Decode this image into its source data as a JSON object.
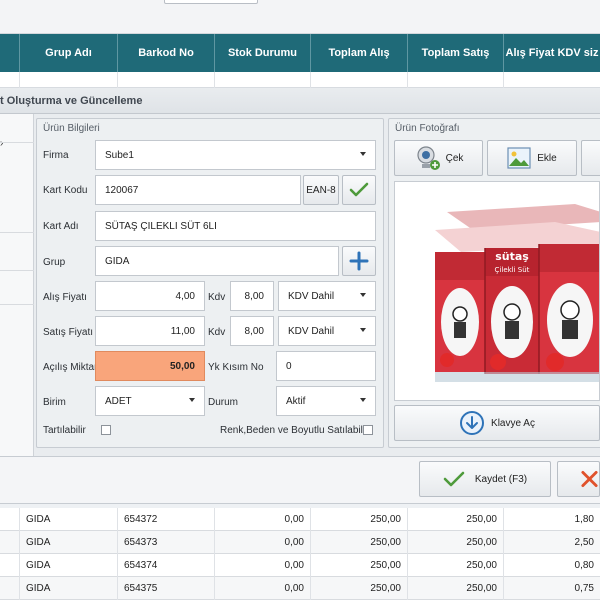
{
  "grid": {
    "columns": [
      "Grup Adı",
      "Barkod No",
      "Stok Durumu",
      "Toplam Alış",
      "Toplam Satış",
      "Alış Fiyat KDV siz"
    ],
    "rows": [
      {
        "grup": "GIDA",
        "barkod": "654372",
        "stok": "0,00",
        "alis": "250,00",
        "satis": "250,00",
        "fiyat": "1,80"
      },
      {
        "grup": "GIDA",
        "barkod": "654373",
        "stok": "0,00",
        "alis": "250,00",
        "satis": "250,00",
        "fiyat": "2,50"
      },
      {
        "grup": "GIDA",
        "barkod": "654374",
        "stok": "0,00",
        "alis": "250,00",
        "satis": "250,00",
        "fiyat": "0,80"
      },
      {
        "grup": "GIDA",
        "barkod": "654375",
        "stok": "0,00",
        "alis": "250,00",
        "satis": "250,00",
        "fiyat": "0,75"
      }
    ]
  },
  "dialog": {
    "title": "t Oluşturma ve Güncelleme"
  },
  "product_info": {
    "group_title": "Ürün Bilgileri",
    "firma_label": "Firma",
    "firma_value": "Sube1",
    "kart_kodu_label": "Kart Kodu",
    "kart_kodu_value": "120067",
    "ean_button": "EAN-8",
    "kart_adi_label": "Kart Adı",
    "kart_adi_value": "SÜTAŞ ÇILEKLI SÜT 6LI",
    "grup_label": "Grup",
    "grup_value": "GIDA",
    "alis_fiyati_label": "Alış Fiyatı",
    "alis_fiyati_value": "4,00",
    "kdv_label": "Kdv",
    "alis_kdv_value": "8,00",
    "alis_kdv_type": "KDV Dahil",
    "satis_fiyati_label": "Satış Fiyatı",
    "satis_fiyati_value": "11,00",
    "satis_kdv_value": "8,00",
    "satis_kdv_type": "KDV Dahil",
    "acilis_miktar_label": "Açılış Miktar",
    "acilis_miktar_value": "50,00",
    "yk_kisim_label": "Yk Kısım No",
    "yk_kisim_value": "0",
    "birim_label": "Birim",
    "birim_value": "ADET",
    "durum_label": "Durum",
    "durum_value": "Aktif",
    "tartilabilir_label": "Tartılabilir",
    "renk_label": "Renk,Beden ve Boyutlu Satılabilir"
  },
  "photo": {
    "group_title": "Ürün Fotoğrafı",
    "cek_button": "Çek",
    "ekle_button": "Ekle",
    "brand_text": "sütaş",
    "product_text": "Çilekli Süt",
    "keyboard_button": "Klavye Aç"
  },
  "footer": {
    "save_button": "Kaydet (F3)"
  },
  "colors": {
    "header_teal": "#1f6a78",
    "highlight_orange": "#f9a57b",
    "accent_blue": "#2e73b8",
    "check_green": "#4e9a3b",
    "cancel_red": "#e0522c"
  }
}
